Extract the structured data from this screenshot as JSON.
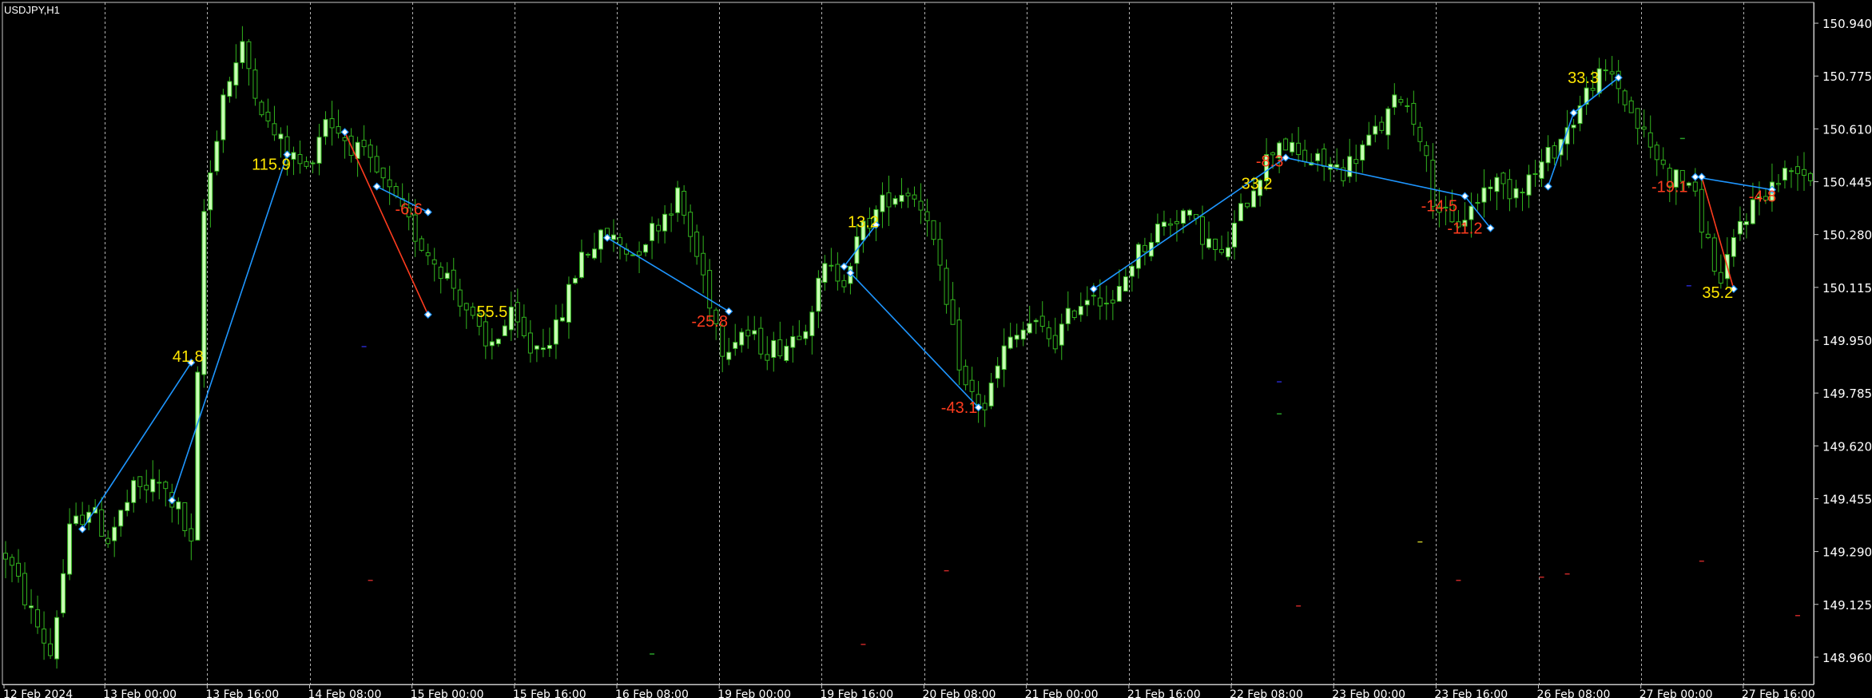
{
  "chart_data": {
    "type": "candlestick",
    "symbol_label": "USDJPY,H1",
    "colors": {
      "background": "#000000",
      "grid": "#d0d0d0",
      "axis": "#c8c8c8",
      "text": "#ffffff",
      "candle_body_up": "#c8ffb4",
      "candle_wick": "#32b41e",
      "zigzag_up": "#1e96ff",
      "zigzag_down": "#ff3c1e",
      "label_positive": "#ffe600",
      "label_negative": "#ff3c1e"
    },
    "ylim": [
      148.875,
      151.005
    ],
    "y_ticks": [
      "150.940",
      "150.775",
      "150.610",
      "150.445",
      "150.280",
      "150.115",
      "149.950",
      "149.785",
      "149.620",
      "149.455",
      "149.290",
      "149.125",
      "148.960"
    ],
    "x_ticks": [
      "12 Feb 2024",
      "13 Feb 00:00",
      "13 Feb 16:00",
      "14 Feb 08:00",
      "15 Feb 00:00",
      "15 Feb 16:00",
      "16 Feb 08:00",
      "19 Feb 00:00",
      "19 Feb 16:00",
      "20 Feb 08:00",
      "21 Feb 00:00",
      "21 Feb 16:00",
      "22 Feb 08:00",
      "23 Feb 00:00",
      "23 Feb 16:00",
      "26 Feb 08:00",
      "27 Feb 00:00",
      "27 Feb 16:00"
    ],
    "x_index_ticks": [
      0,
      16,
      32,
      48,
      64,
      80,
      96,
      112,
      128,
      144,
      160,
      176,
      192,
      208,
      224,
      240,
      256,
      272
    ],
    "bars_total": 283,
    "price_path": [
      [
        0,
        149.28
      ],
      [
        4,
        149.1
      ],
      [
        7,
        148.97
      ],
      [
        10,
        149.35
      ],
      [
        13,
        149.43
      ],
      [
        16,
        149.33
      ],
      [
        20,
        149.48
      ],
      [
        24,
        149.5
      ],
      [
        27,
        149.42
      ],
      [
        29,
        149.3
      ],
      [
        31,
        150.35
      ],
      [
        34,
        150.72
      ],
      [
        37,
        150.86
      ],
      [
        41,
        150.62
      ],
      [
        44,
        150.54
      ],
      [
        47,
        150.48
      ],
      [
        50,
        150.65
      ],
      [
        53,
        150.58
      ],
      [
        56,
        150.52
      ],
      [
        59,
        150.44
      ],
      [
        62,
        150.34
      ],
      [
        65,
        150.25
      ],
      [
        69,
        150.15
      ],
      [
        72,
        150.05
      ],
      [
        75,
        149.92
      ],
      [
        79,
        150.02
      ],
      [
        82,
        149.92
      ],
      [
        86,
        149.98
      ],
      [
        90,
        150.22
      ],
      [
        94,
        150.28
      ],
      [
        98,
        150.22
      ],
      [
        102,
        150.32
      ],
      [
        105,
        150.4
      ],
      [
        109,
        150.15
      ],
      [
        112,
        149.93
      ],
      [
        115,
        149.98
      ],
      [
        119,
        149.92
      ],
      [
        122,
        149.94
      ],
      [
        125,
        150.01
      ],
      [
        128,
        150.17
      ],
      [
        131,
        150.15
      ],
      [
        134,
        150.3
      ],
      [
        138,
        150.4
      ],
      [
        141,
        150.42
      ],
      [
        144,
        150.35
      ],
      [
        147,
        150.05
      ],
      [
        150,
        149.8
      ],
      [
        153,
        149.74
      ],
      [
        156,
        149.92
      ],
      [
        160,
        150.0
      ],
      [
        164,
        149.95
      ],
      [
        167,
        150.05
      ],
      [
        170,
        150.11
      ],
      [
        173,
        150.05
      ],
      [
        176,
        150.2
      ],
      [
        180,
        150.3
      ],
      [
        184,
        150.35
      ],
      [
        187,
        150.28
      ],
      [
        190,
        150.2
      ],
      [
        193,
        150.35
      ],
      [
        196,
        150.48
      ],
      [
        199,
        150.58
      ],
      [
        202,
        150.52
      ],
      [
        206,
        150.5
      ],
      [
        209,
        150.48
      ],
      [
        212,
        150.55
      ],
      [
        215,
        150.62
      ],
      [
        218,
        150.72
      ],
      [
        221,
        150.6
      ],
      [
        223,
        150.4
      ],
      [
        226,
        150.3
      ],
      [
        229,
        150.36
      ],
      [
        232,
        150.45
      ],
      [
        235,
        150.42
      ],
      [
        239,
        150.47
      ],
      [
        242,
        150.55
      ],
      [
        245,
        150.64
      ],
      [
        248,
        150.76
      ],
      [
        251,
        150.78
      ],
      [
        254,
        150.66
      ],
      [
        257,
        150.55
      ],
      [
        260,
        150.46
      ],
      [
        263,
        150.45
      ],
      [
        266,
        150.25
      ],
      [
        268,
        150.12
      ],
      [
        271,
        150.32
      ],
      [
        274,
        150.4
      ],
      [
        277,
        150.45
      ],
      [
        280,
        150.5
      ],
      [
        282,
        150.46
      ]
    ],
    "zigzag": [
      {
        "i": 12,
        "price": 149.36,
        "color": "up"
      },
      {
        "i": 29,
        "price": 149.88,
        "color": "up"
      },
      {
        "i": 26,
        "price": 149.45,
        "color": "up"
      },
      {
        "i": 44,
        "price": 150.53,
        "color": "up"
      },
      {
        "i": 53,
        "price": 150.6,
        "color": "down"
      },
      {
        "i": 66,
        "price": 150.03,
        "color": "down"
      },
      {
        "i": 58,
        "price": 150.43,
        "color": "up"
      },
      {
        "i": 66,
        "price": 150.35,
        "color": "up"
      },
      {
        "i": 94,
        "price": 150.27,
        "color": "up"
      },
      {
        "i": 113,
        "price": 150.04,
        "color": "up"
      },
      {
        "i": 131,
        "price": 150.18,
        "color": "up"
      },
      {
        "i": 136,
        "price": 150.31,
        "color": "up"
      },
      {
        "i": 132,
        "price": 150.16,
        "color": "up"
      },
      {
        "i": 152,
        "price": 149.74,
        "color": "up"
      },
      {
        "i": 170,
        "price": 150.11,
        "color": "up"
      },
      {
        "i": 200,
        "price": 150.52,
        "color": "up"
      },
      {
        "i": 228,
        "price": 150.4,
        "color": "up"
      },
      {
        "i": 232,
        "price": 150.3,
        "color": "up"
      },
      {
        "i": 241,
        "price": 150.43,
        "color": "up"
      },
      {
        "i": 245,
        "price": 150.66,
        "color": "up"
      },
      {
        "i": 252,
        "price": 150.77,
        "color": "up"
      },
      {
        "i": 265,
        "price": 150.46,
        "color": "down"
      },
      {
        "i": 270,
        "price": 150.11,
        "color": "down"
      },
      {
        "i": 264,
        "price": 150.46,
        "color": "up"
      },
      {
        "i": 276,
        "price": 150.42,
        "color": "up"
      }
    ],
    "zigzag_segments": [
      [
        0,
        1
      ],
      [
        2,
        3
      ],
      [
        4,
        5
      ],
      [
        6,
        7
      ],
      [
        8,
        9
      ],
      [
        10,
        11
      ],
      [
        12,
        13
      ],
      [
        14,
        15
      ],
      [
        15,
        16
      ],
      [
        16,
        17
      ],
      [
        18,
        19
      ],
      [
        19,
        20
      ],
      [
        20,
        19
      ],
      [
        21,
        22
      ],
      [
        23,
        24
      ]
    ],
    "labels": [
      {
        "text": "41.8",
        "i": 28.5,
        "price": 149.9,
        "kind": "positive"
      },
      {
        "text": "115.9",
        "i": 41.5,
        "price": 150.5,
        "kind": "positive"
      },
      {
        "text": "-6.6",
        "i": 63,
        "price": 150.36,
        "kind": "negative"
      },
      {
        "text": "55.5",
        "i": 76,
        "price": 150.04,
        "kind": "positive"
      },
      {
        "text": "-25.8",
        "i": 110,
        "price": 150.01,
        "kind": "negative"
      },
      {
        "text": "13.2",
        "i": 134,
        "price": 150.32,
        "kind": "positive"
      },
      {
        "text": "-43.1",
        "i": 149,
        "price": 149.74,
        "kind": "negative"
      },
      {
        "text": "-8.3",
        "i": 197.5,
        "price": 150.51,
        "kind": "negative"
      },
      {
        "text": "33.2",
        "i": 195.5,
        "price": 150.44,
        "kind": "positive"
      },
      {
        "text": "-14.5",
        "i": 224,
        "price": 150.37,
        "kind": "negative"
      },
      {
        "text": "-11.2",
        "i": 228,
        "price": 150.3,
        "kind": "negative"
      },
      {
        "text": "33.3",
        "i": 246.5,
        "price": 150.77,
        "kind": "positive"
      },
      {
        "text": "-19.1",
        "i": 260,
        "price": 150.43,
        "kind": "negative"
      },
      {
        "text": "35.2",
        "i": 267.5,
        "price": 150.1,
        "kind": "positive"
      },
      {
        "text": "-4.8",
        "i": 274.5,
        "price": 150.4,
        "kind": "negative"
      }
    ],
    "stray_marks": [
      {
        "i": 56,
        "price": 149.93,
        "color": "#2828c8"
      },
      {
        "i": 57,
        "price": 149.2,
        "color": "#c82828"
      },
      {
        "i": 101,
        "price": 148.97,
        "color": "#28a028"
      },
      {
        "i": 134,
        "price": 149.0,
        "color": "#c82828"
      },
      {
        "i": 147,
        "price": 149.23,
        "color": "#c82828"
      },
      {
        "i": 199,
        "price": 149.82,
        "color": "#2828c8"
      },
      {
        "i": 199,
        "price": 149.72,
        "color": "#28a028"
      },
      {
        "i": 202,
        "price": 149.12,
        "color": "#c82828"
      },
      {
        "i": 221,
        "price": 149.32,
        "color": "#c8c828"
      },
      {
        "i": 227,
        "price": 149.2,
        "color": "#c82828"
      },
      {
        "i": 240,
        "price": 149.21,
        "color": "#c82828"
      },
      {
        "i": 244,
        "price": 149.22,
        "color": "#c82828"
      },
      {
        "i": 262,
        "price": 150.58,
        "color": "#28a028"
      },
      {
        "i": 263,
        "price": 150.12,
        "color": "#2828c8"
      },
      {
        "i": 265,
        "price": 149.26,
        "color": "#c82828"
      },
      {
        "i": 280,
        "price": 149.09,
        "color": "#c82828"
      }
    ]
  }
}
